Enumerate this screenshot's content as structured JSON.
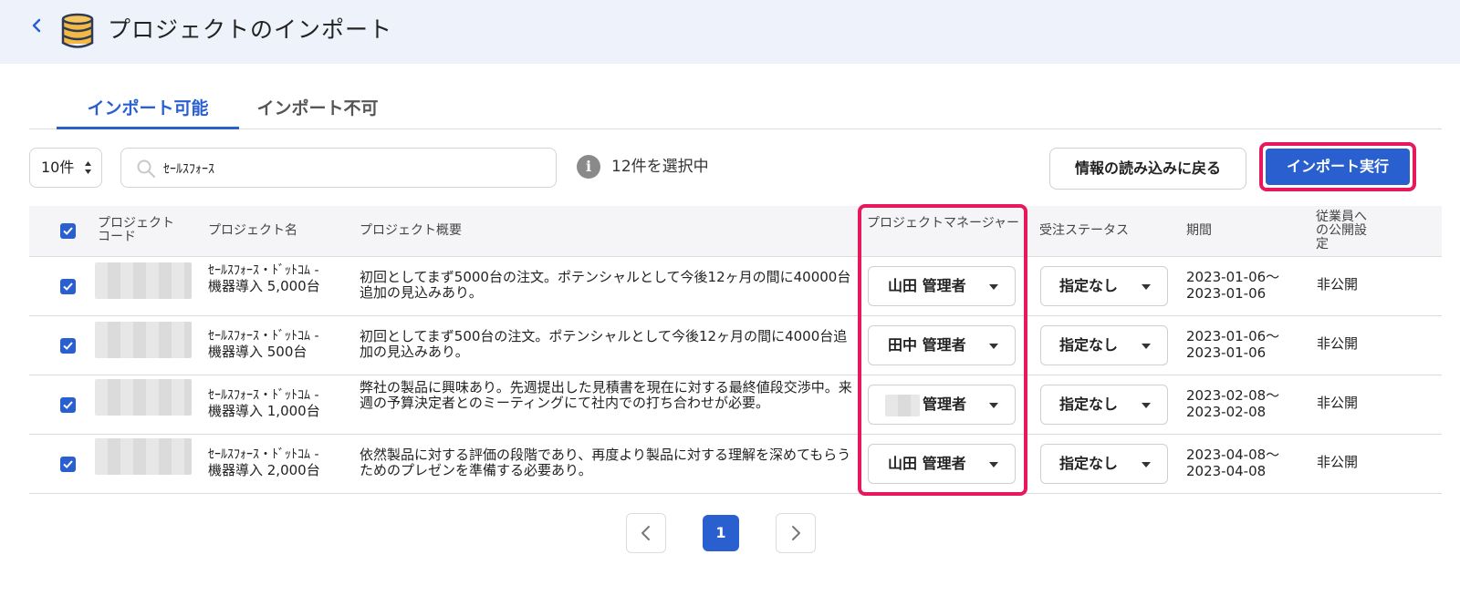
{
  "header": {
    "title": "プロジェクトのインポート"
  },
  "tabs": [
    {
      "label": "インポート可能"
    },
    {
      "label": "インポート不可"
    }
  ],
  "toolbar": {
    "per_page": "10件",
    "search_value": "ｾｰﾙｽﾌｫｰｽ",
    "selected_info": "12件を選択中",
    "back_button": "情報の読み込みに戻る",
    "import_button": "インポート実行"
  },
  "table": {
    "columns": {
      "code": "プロジェクト\nコード",
      "name": "プロジェクト名",
      "summary": "プロジェクト概要",
      "manager": "プロジェクトマネージャー",
      "status": "受注ステータス",
      "period": "期間",
      "publish": "従業員への公開設定"
    },
    "rows": [
      {
        "name_line1": "ｾｰﾙｽﾌｫｰｽ・ﾄﾞｯﾄｺﾑ -",
        "name_line2": "機器導入 5,000台",
        "summary": "初回としてまず5000台の注文。ポテンシャルとして今後12ヶ月の間に40000台追加の見込みあり。",
        "manager": "山田 管理者",
        "status": "指定なし",
        "period_start": "2023-01-06〜",
        "period_end": "2023-01-06",
        "publish": "非公開"
      },
      {
        "name_line1": "ｾｰﾙｽﾌｫｰｽ・ﾄﾞｯﾄｺﾑ -",
        "name_line2": "機器導入 500台",
        "summary": "初回としてまず500台の注文。ポテンシャルとして今後12ヶ月の間に4000台追加の見込みあり。",
        "manager": "田中 管理者",
        "status": "指定なし",
        "period_start": "2023-01-06〜",
        "period_end": "2023-01-06",
        "publish": "非公開"
      },
      {
        "name_line1": "ｾｰﾙｽﾌｫｰｽ・ﾄﾞｯﾄｺﾑ -",
        "name_line2": "機器導入 1,000台",
        "summary": "弊社の製品に興味あり。先週提出した見積書を現在に対する最終値段交渉中。来週の予算決定者とのミーティングにて社内での打ち合わせが必要。",
        "manager": "管理者",
        "status": "指定なし",
        "period_start": "2023-02-08〜",
        "period_end": "2023-02-08",
        "publish": "非公開"
      },
      {
        "name_line1": "ｾｰﾙｽﾌｫｰｽ・ﾄﾞｯﾄｺﾑ -",
        "name_line2": "機器導入 2,000台",
        "summary": "依然製品に対する評価の段階であり、再度より製品に対する理解を深めてもらうためのプレゼンを準備する必要あり。",
        "manager": "山田 管理者",
        "status": "指定なし",
        "period_start": "2023-04-08〜",
        "period_end": "2023-04-08",
        "publish": "非公開"
      }
    ]
  },
  "pagination": {
    "current": "1"
  },
  "colors": {
    "accent": "#2a5fd0",
    "highlight": "#e8185d",
    "header_bg": "#eef2fb"
  }
}
